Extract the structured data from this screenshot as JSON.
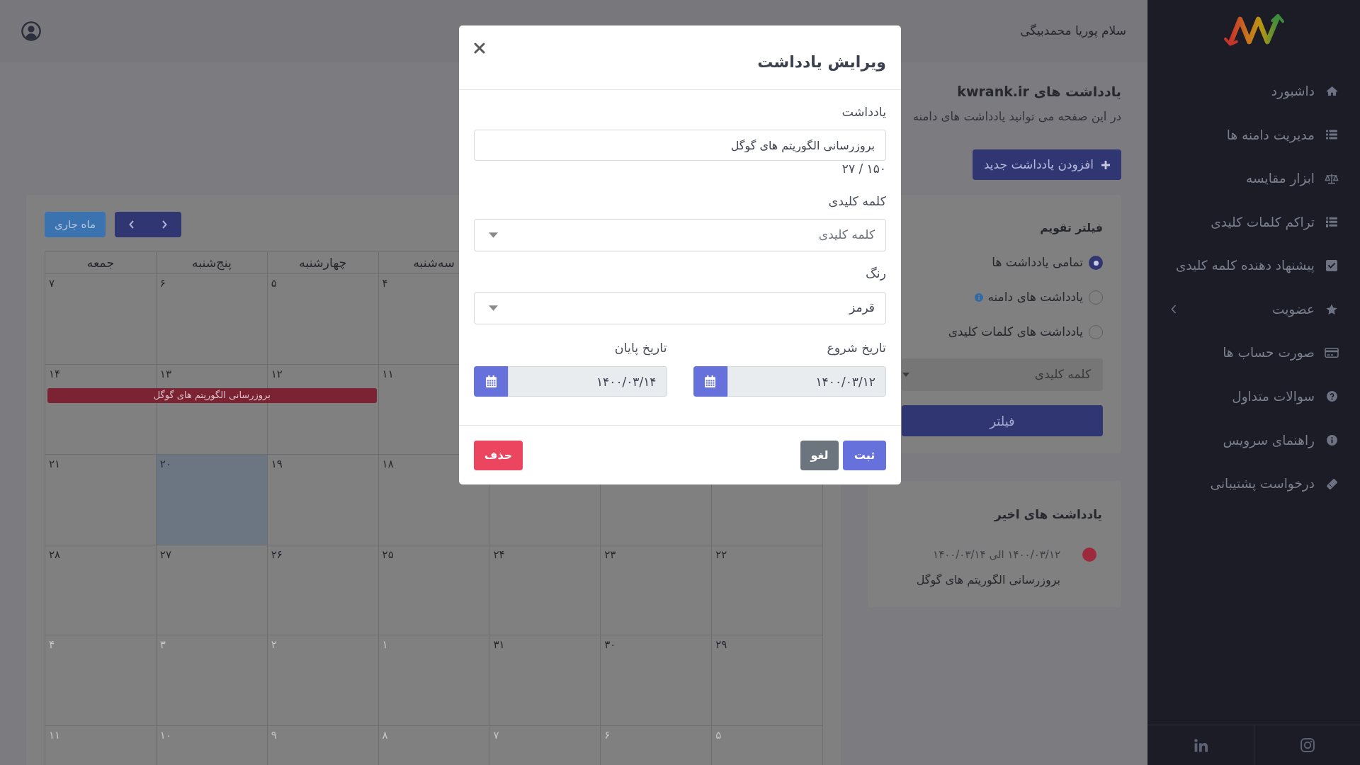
{
  "sidebar": {
    "items": [
      {
        "label": "داشبورد",
        "has_submenu": false
      },
      {
        "label": "مدیریت دامنه ها",
        "has_submenu": false
      },
      {
        "label": "ابزار مقایسه",
        "has_submenu": false
      },
      {
        "label": "تراکم کلمات کلیدی",
        "has_submenu": false
      },
      {
        "label": "پیشنهاد دهنده کلمه کلیدی",
        "has_submenu": false
      },
      {
        "label": "عضویت",
        "has_submenu": true
      },
      {
        "label": "صورت حساب ها",
        "has_submenu": false
      },
      {
        "label": "سوالات متداول",
        "has_submenu": false
      },
      {
        "label": "راهنمای سرویس",
        "has_submenu": false
      },
      {
        "label": "درخواست پشتیبانی",
        "has_submenu": false
      }
    ]
  },
  "header": {
    "greeting": "سلام پوریا محمدبیگی"
  },
  "page": {
    "title": "یادداشت های kwrank.ir",
    "subtitle": "در این صفحه می توانید یادداشت های دامنه",
    "add_button": "افزودن یادداشت جدید"
  },
  "calendar": {
    "current_month_button": "ماه جاری",
    "weekdays": [
      "سه‌شنبه",
      "چهارشنبه",
      "پنج‌شنبه",
      "جمعه"
    ],
    "weeks": [
      {
        "days": [
          {
            "day": "۴",
            "muted": false,
            "today": false
          },
          {
            "day": "۵",
            "muted": false,
            "today": false
          },
          {
            "day": "۶",
            "muted": false,
            "today": false
          },
          {
            "day": "۷",
            "muted": false,
            "today": false
          }
        ]
      },
      {
        "days": [
          {
            "day": "۱۱",
            "muted": false,
            "today": false
          },
          {
            "day": "۱۲",
            "muted": false,
            "today": false,
            "in_event": true
          },
          {
            "day": "۱۳",
            "muted": false,
            "today": false,
            "in_event": true
          },
          {
            "day": "۱۴",
            "muted": false,
            "today": false,
            "in_event": true
          }
        ],
        "events": [
          {
            "title": "بروزرسانی الگوریتم های گوگل",
            "color": "#7b2233"
          }
        ]
      },
      {
        "days": [
          {
            "day": "۱۸",
            "muted": false,
            "today": false
          },
          {
            "day": "۱۹",
            "muted": false,
            "today": false
          },
          {
            "day": "۲۰",
            "muted": false,
            "today": true
          },
          {
            "day": "۲۱",
            "muted": false,
            "today": false
          }
        ]
      },
      {
        "days": [
          {
            "day": "۲۲",
            "muted": false,
            "today": false
          },
          {
            "day": "۲۳",
            "muted": false,
            "today": false
          },
          {
            "day": "۲۴",
            "muted": false,
            "today": false
          },
          {
            "day": "۲۵",
            "muted": false,
            "today": false
          },
          {
            "day": "۲۶",
            "muted": false,
            "today": false
          },
          {
            "day": "۲۷",
            "muted": false,
            "today": false
          },
          {
            "day": "۲۸",
            "muted": false,
            "today": false
          }
        ]
      },
      {
        "days": [
          {
            "day": "۲۹",
            "muted": false,
            "today": false
          },
          {
            "day": "۳۰",
            "muted": false,
            "today": false
          },
          {
            "day": "۳۱",
            "muted": false,
            "today": false
          },
          {
            "day": "۱",
            "muted": true,
            "today": false
          },
          {
            "day": "۲",
            "muted": true,
            "today": false
          },
          {
            "day": "۳",
            "muted": true,
            "today": false
          },
          {
            "day": "۴",
            "muted": true,
            "today": false
          }
        ]
      },
      {
        "days": [
          {
            "day": "۵",
            "muted": true,
            "today": false
          },
          {
            "day": "۶",
            "muted": true,
            "today": false
          },
          {
            "day": "۷",
            "muted": true,
            "today": false
          },
          {
            "day": "۸",
            "muted": true,
            "today": false
          },
          {
            "day": "۹",
            "muted": true,
            "today": false
          },
          {
            "day": "۱۰",
            "muted": true,
            "today": false
          },
          {
            "day": "۱۱",
            "muted": true,
            "today": false
          }
        ]
      }
    ]
  },
  "filter": {
    "title": "فیلتر تقویم",
    "options": [
      {
        "label": "تمامی یادداشت ها",
        "selected": true
      },
      {
        "label": "یادداشت های دامنه",
        "selected": false,
        "info": true
      },
      {
        "label": "یادداشت های کلمات کلیدی",
        "selected": false
      }
    ],
    "keyword_select": {
      "placeholder": "کلمه کلیدی",
      "disabled": true
    },
    "button": "فیلتر"
  },
  "recent": {
    "title": "یادداشت های اخیر",
    "items": [
      {
        "color": "#9d2a3c",
        "date_range": "۱۴۰۰/۰۳/۱۲ الی ۱۴۰۰/۰۳/۱۴",
        "note": "بروزرسانی الگوریتم های گوگل"
      }
    ]
  },
  "modal": {
    "title": "ویرایش یادداشت",
    "note": {
      "label": "یادداشت",
      "value": "بروزرسانی الگوریتم های گوگل",
      "counter": "۲۷ / ۱۵۰"
    },
    "keyword": {
      "label": "کلمه کلیدی",
      "placeholder": "کلمه کلیدی"
    },
    "color": {
      "label": "رنگ",
      "value": "قرمز"
    },
    "start_date": {
      "label": "تاریخ شروع",
      "value": "۱۴۰۰/۰۳/۱۲"
    },
    "end_date": {
      "label": "تاریخ پایان",
      "value": "۱۴۰۰/۰۳/۱۴"
    },
    "buttons": [
      {
        "label": "ثبت",
        "kind": "primary"
      },
      {
        "label": "لغو",
        "kind": "secondary"
      },
      {
        "label": "حذف",
        "kind": "danger"
      }
    ]
  }
}
